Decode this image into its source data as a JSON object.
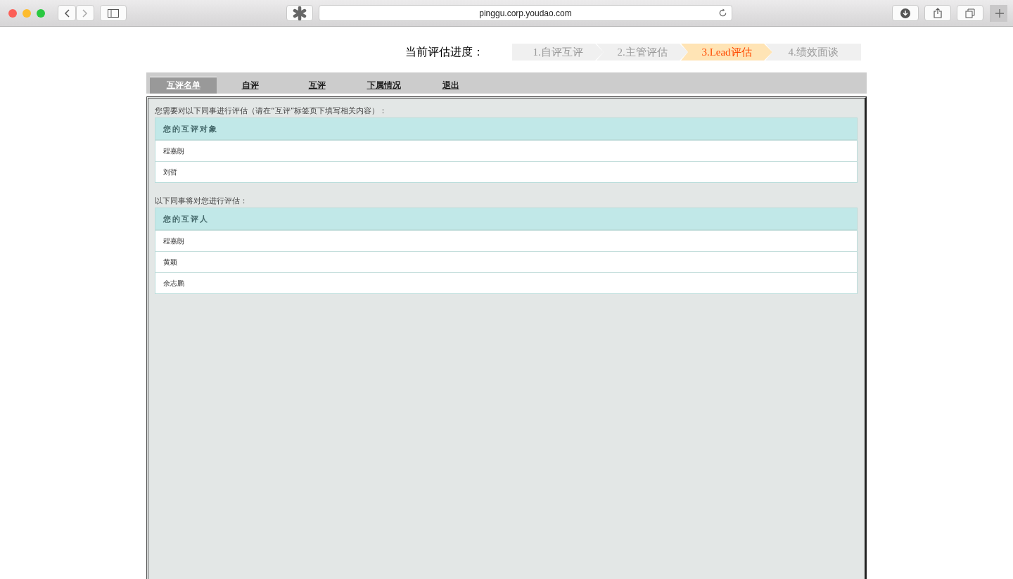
{
  "browser": {
    "url": "pinggu.corp.youdao.com"
  },
  "progress": {
    "label": "当前评估进度：",
    "steps": [
      {
        "label": "1.自评互评",
        "selected": false
      },
      {
        "label": "2.主管评估",
        "selected": false
      },
      {
        "label": "3.Lead评估",
        "selected": true
      },
      {
        "label": "4.绩效面谈",
        "selected": false
      }
    ]
  },
  "tabs": [
    {
      "label": "互评名单",
      "selected": true
    },
    {
      "label": "自评",
      "selected": false
    },
    {
      "label": "互评",
      "selected": false
    },
    {
      "label": "下属情况",
      "selected": false
    },
    {
      "label": "退出",
      "selected": false
    }
  ],
  "sections": [
    {
      "caption": "您需要对以下同事进行评估（请在“互评”标签页下填写相关内容）：",
      "header": "您的互评对象",
      "rows": [
        "程嘉朗",
        "刘哲"
      ]
    },
    {
      "caption": "以下同事将对您进行评估：",
      "header": "您的互评人",
      "rows": [
        "程嘉朗",
        "黄颖",
        "余志鹏"
      ]
    }
  ]
}
